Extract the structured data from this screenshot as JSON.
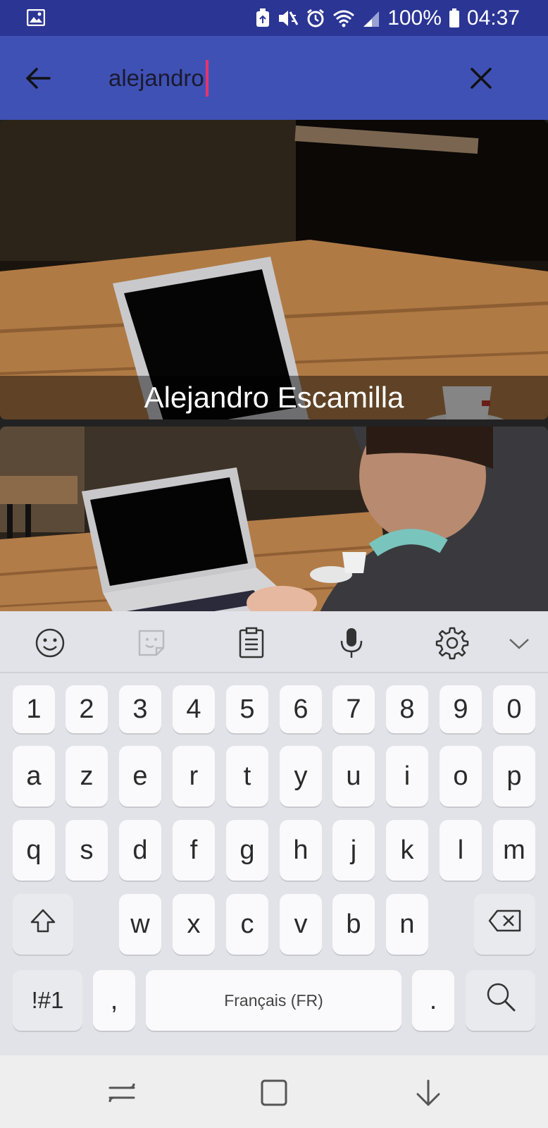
{
  "status_bar": {
    "battery": "100%",
    "time": "04:37",
    "icons": [
      "gallery-icon",
      "recycle-icon",
      "mute-vibrate-icon",
      "alarm-icon",
      "wifi-icon",
      "signal-icon",
      "battery-icon"
    ]
  },
  "search": {
    "query": "alejandro",
    "back_icon": "arrow-back-icon",
    "clear_icon": "close-icon"
  },
  "results": [
    {
      "author": "Alejandro Escamilla"
    },
    {
      "author": ""
    }
  ],
  "keyboard": {
    "toolbar": [
      "emoji-icon",
      "sticker-icon",
      "clipboard-icon",
      "microphone-icon",
      "settings-icon",
      "chevron-down-icon"
    ],
    "row_numbers": [
      "1",
      "2",
      "3",
      "4",
      "5",
      "6",
      "7",
      "8",
      "9",
      "0"
    ],
    "row1": [
      "a",
      "z",
      "e",
      "r",
      "t",
      "y",
      "u",
      "i",
      "o",
      "p"
    ],
    "row2": [
      "q",
      "s",
      "d",
      "f",
      "g",
      "h",
      "j",
      "k",
      "l",
      "m"
    ],
    "row3": [
      "w",
      "x",
      "c",
      "v",
      "b",
      "n"
    ],
    "symbols_label": "!#1",
    "comma_label": ",",
    "space_label": "Français (FR)",
    "period_label": ".",
    "shift_icon": "shift-icon",
    "backspace_icon": "backspace-icon",
    "search_icon": "search-icon"
  },
  "nav_bar": [
    "recent-apps-icon",
    "home-icon",
    "back-down-icon"
  ],
  "colors": {
    "status_bar": "#2b3594",
    "app_bar": "#3f51b5",
    "caret": "#e8336a"
  }
}
